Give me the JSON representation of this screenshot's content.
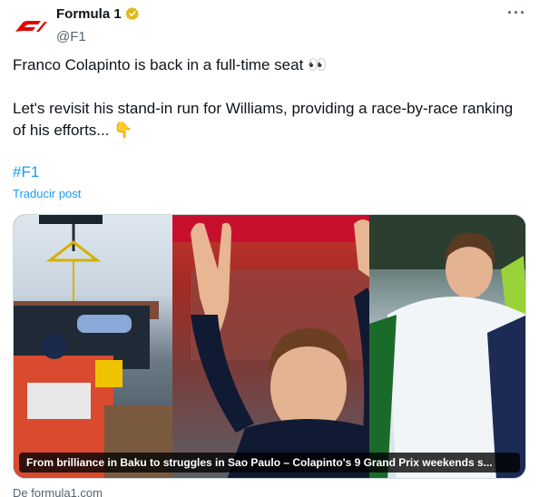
{
  "author": {
    "display_name": "Formula 1",
    "handle": "@F1",
    "logo_icon": "f1-logo",
    "verified_icon": "verified-gold-badge-icon",
    "brand_color": "#e10600",
    "verified_color": "#e2b719"
  },
  "more_icon": "more-options-icon",
  "tweet": {
    "paragraph_1": "Franco Colapinto is back in a full-time seat 👀",
    "paragraph_2": "Let's revisit his stand-in run for Williams, providing a race-by-race ranking of his efforts... 👇",
    "hashtag": "#F1",
    "translate_label": "Traducir post"
  },
  "media": {
    "caption": "From brilliance in Baku to struggles in Sao Paulo – Colapinto's 9 Grand Prix weekends s...",
    "source": "De formula1.com"
  },
  "colors": {
    "link": "#1d9bf0",
    "secondary_text": "#536471"
  }
}
